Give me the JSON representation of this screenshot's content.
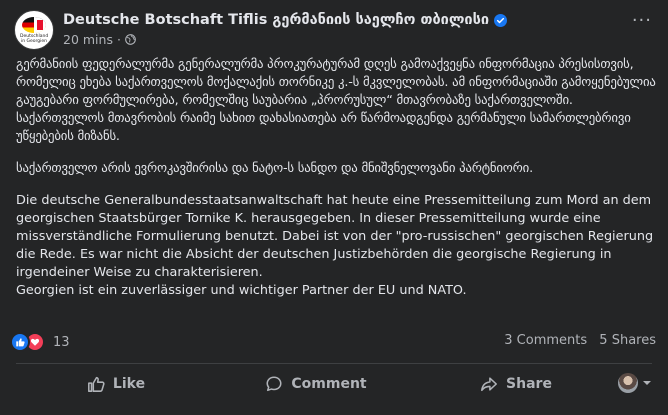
{
  "post": {
    "page_name": "Deutsche Botschaft Tiflis გერმანიის საელჩო თბილისი",
    "avatar_caption": "Deutschland in Georgien",
    "time": "20 mins",
    "dot": "·",
    "more": "···",
    "paragraphs_ge": [
      "გერმანიის ფედერალურმა გენერალურმა პროკურატურამ დღეს გამოაქვეყნა ინფორმაცია პრესისთვის, რომელიც ეხება საქართველოს მოქალაქის თორნიკე კ.-ს მკვლელობას. ამ ინფორმაციაში გამოყენებულია გაუგებარი ფორმულირება, რომელშიც  საუბარია „პრორუსულ“ მთავრობაზე საქართველოში. საქართველოს მთავრობის რაიმე სახით დახასიათება არ წარმოადგენდა გერმანული სამართლებრივი უწყებების მიზანს.",
      "საქართველო არის ევროკავშირისა და ნატო-ს სანდო და მნიშვნელოვანი პარტნიორი."
    ],
    "paragraph_de": [
      "Die deutsche Generalbundesstaatsanwaltschaft hat heute eine Pressemitteilung zum Mord an dem georgischen Staatsbürger Tornike K. herausgegeben. In dieser Pressemitteilung wurde eine missverständliche Formulierung benutzt. Dabei ist von der \"pro-russischen\" georgischen Regierung die Rede. Es war nicht die Absicht der deutschen Justizbehörden die georgische Regierung in irgendeiner Weise zu charakterisieren.",
      "Georgien ist ein zuverlässiger und wichtiger Partner der EU und NATO."
    ]
  },
  "stats": {
    "reactions_count": "13",
    "comments": "3 Comments",
    "shares": "5 Shares"
  },
  "actions": {
    "like": "Like",
    "comment": "Comment",
    "share": "Share"
  },
  "colors": {
    "background": "#242526",
    "text": "#e4e6eb",
    "secondary_text": "#b0b3b8",
    "like_blue": "#1877f2",
    "love_red": "#f33e58"
  },
  "icons": [
    "verified-badge-icon",
    "globe-icon",
    "more-options-icon",
    "like-reaction-icon",
    "love-reaction-icon",
    "thumbs-up-icon",
    "comment-bubble-icon",
    "share-arrow-icon",
    "chevron-down-icon"
  ]
}
